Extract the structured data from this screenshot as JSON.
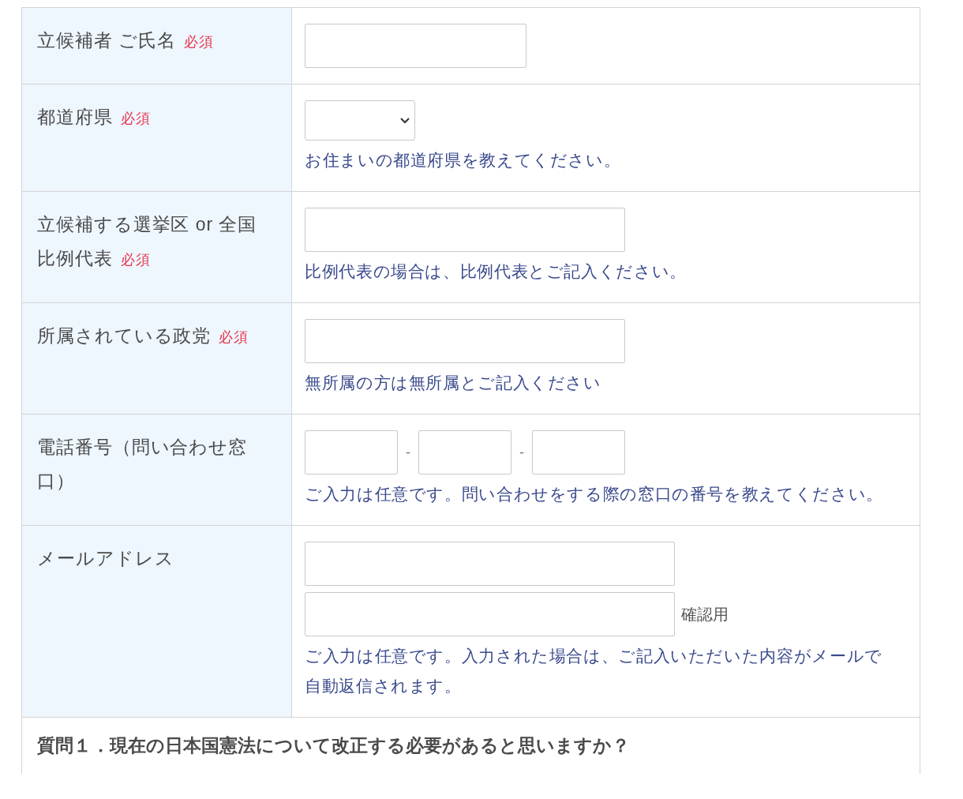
{
  "form_rows": [
    {
      "label": "立候補者 ご氏名",
      "badge": "必須",
      "kind": "name"
    },
    {
      "label": "都道府県",
      "badge": "必須",
      "kind": "select",
      "hint": "お住まいの都道府県を教えてください。"
    },
    {
      "label": "立候補する選挙区 or 全国比例代表",
      "badge": "必須",
      "kind": "text",
      "hint": "比例代表の場合は、比例代表とご記入ください。"
    },
    {
      "label": "所属されている政党",
      "badge": "必須",
      "kind": "text",
      "hint": "無所属の方は無所属とご記入ください"
    },
    {
      "label": "電話番号（問い合わせ窓口）",
      "kind": "phone",
      "separators": [
        "-",
        "-"
      ],
      "hint": "ご入力は任意です。問い合わせをする際の窓口の番号を教えてください。"
    },
    {
      "label": "メールアドレス",
      "kind": "email",
      "confirm_label": "確認用",
      "hint": "ご入力は任意です。入力された場合は、ご記入いただいた内容がメールで自動返信されます。"
    }
  ],
  "question": {
    "text": "質問１．現在の日本国憲法について改正する必要があると思いますか？"
  }
}
